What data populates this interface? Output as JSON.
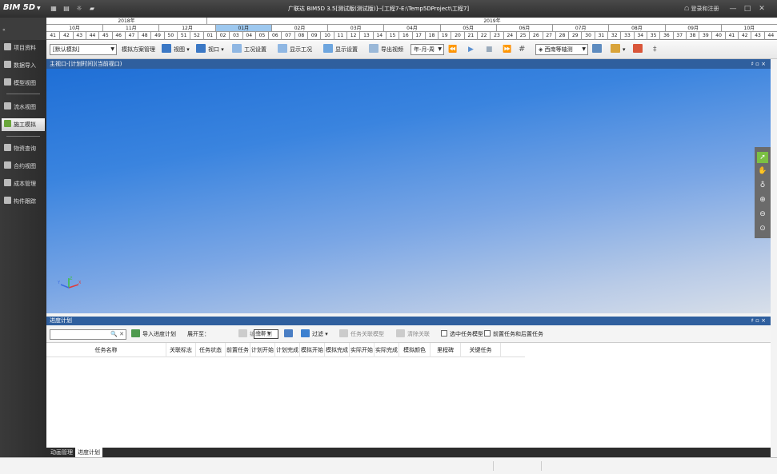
{
  "titlebar": {
    "logo": "BIM 5D",
    "title": "广联达 BIM5D 3.5[测试版(测试版)]--[工程7-E:\\Temp5DProject\\工程7]",
    "login": "登录和注册",
    "minimize": "—",
    "restore": "□",
    "close": "✕"
  },
  "timeline": {
    "left_label": "«",
    "years": [
      "2018年",
      "2019年"
    ],
    "months": [
      "10月",
      "11月",
      "12月",
      "01月",
      "02月",
      "03月",
      "04月",
      "05月",
      "06月",
      "07月",
      "08月",
      "09月",
      "10月"
    ],
    "weeks": [
      "41",
      "42",
      "43",
      "44",
      "45",
      "46",
      "47",
      "48",
      "49",
      "50",
      "51",
      "52",
      "01",
      "02",
      "03",
      "04",
      "05",
      "06",
      "07",
      "08",
      "09",
      "10",
      "11",
      "12",
      "13",
      "14",
      "15",
      "16",
      "17",
      "18",
      "19",
      "20",
      "21",
      "22",
      "23",
      "24",
      "25",
      "26",
      "27",
      "28",
      "29",
      "30",
      "31",
      "32",
      "33",
      "34",
      "35",
      "36",
      "37",
      "38",
      "39",
      "40",
      "41",
      "42",
      "43",
      "44"
    ],
    "selected_month": "01月"
  },
  "sidebar": {
    "items": [
      {
        "label": "项目资料"
      },
      {
        "label": "数据导入"
      },
      {
        "label": "模型视图"
      },
      {
        "label": "流水视图"
      },
      {
        "label": "施工模拟"
      },
      {
        "label": "物资查询"
      },
      {
        "label": "合约视图"
      },
      {
        "label": "成本管理"
      },
      {
        "label": "构件跟踪"
      }
    ],
    "active_index": 4
  },
  "toolbar": {
    "scheme_select": "[默认模拟]",
    "scheme_manage": "模拟方案管理",
    "view": "视图",
    "viewport": "视口",
    "work_settings": "工况设置",
    "show_work": "显示工况",
    "show_settings": "显示设置",
    "export_video": "导出视频",
    "date_format": "年-月-周",
    "view_select": "西南等轴测"
  },
  "viewport": {
    "title": "主视口-[计划时间](当前视口)",
    "ctrl": "♯ ▫ ×",
    "axes": {
      "x": "X",
      "y": "Y",
      "z": "Z"
    }
  },
  "schedule_panel": {
    "title": "进度计划",
    "ctrl": "♯ ▫ ×",
    "search_icons": "🔍 ✕",
    "import_schedule": "导入进度计划",
    "expand_to": "展开至：",
    "expand_value": "全部",
    "edit_plan": "编辑计划",
    "filter": "过滤",
    "task_link_model": "任务关联模型",
    "clear_link": "清除关联",
    "select_task_model": "选中任务模型",
    "display_task_prev": "前置任务和后置任务",
    "columns": [
      "任务名称",
      "关联标志",
      "任务状态",
      "前置任务",
      "计划开始",
      "计划完成",
      "模拟开始",
      "模拟完成",
      "实际开始",
      "实际完成",
      "模拟颜色",
      "里程碑",
      "关键任务"
    ]
  },
  "panel_tabs": {
    "tabs": [
      "动画管理",
      "进度计划"
    ],
    "active_index": 1
  }
}
